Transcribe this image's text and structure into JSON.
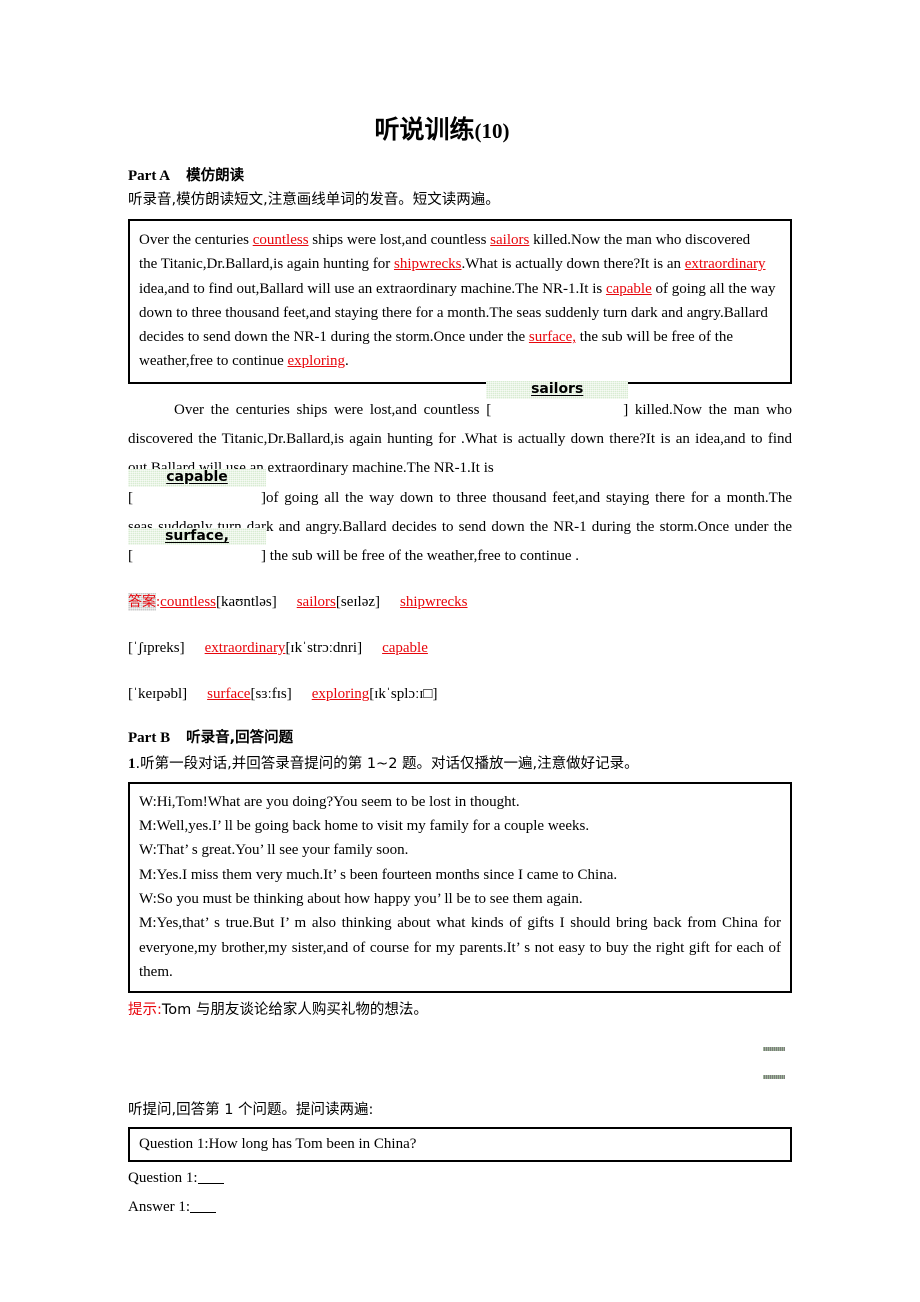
{
  "title": {
    "text": "听说训练",
    "number": "(10)"
  },
  "part_a": {
    "label": "Part A",
    "cn_label": "模仿朗读",
    "instruction": "听录音,模仿朗读短文,注意画线单词的发音。短文读两遍。",
    "passage_lines": [
      {
        "segments": [
          {
            "t": "Over the centuries ",
            "s": "plain"
          },
          {
            "t": "countless",
            "s": "underline-red"
          },
          {
            "t": " ships were lost,and countless ",
            "s": "plain"
          },
          {
            "t": "sailors",
            "s": "underline-red"
          },
          {
            "t": " killed.Now the man who discovered",
            "s": "plain"
          }
        ]
      },
      {
        "segments": [
          {
            "t": " the Titanic,Dr.Ballard,is again hunting for ",
            "s": "plain"
          },
          {
            "t": "shipwrecks",
            "s": "underline-red"
          },
          {
            "t": ".What is actually down there?It is an ",
            "s": "plain"
          },
          {
            "t": "extraordinary",
            "s": "underline-red"
          },
          {
            "t": " idea,and to find out,Ballard will use an extraordinary machine.The NR-1.It is ",
            "s": "plain"
          },
          {
            "t": "capable",
            "s": "underline-red"
          },
          {
            "t": " of going all the way down to three thousand feet,and staying there for a month.The seas suddenly turn dark and angry.Ballard decides to send down the NR-1 during the storm.Once under the ",
            "s": "plain"
          },
          {
            "t": "surface,",
            "s": "underline-red"
          },
          {
            "t": " the sub will be free of the weather,free to continue ",
            "s": "plain"
          },
          {
            "t": "exploring",
            "s": "underline-red"
          },
          {
            "t": ".",
            "s": "plain"
          }
        ]
      }
    ],
    "gap_passage": {
      "p1_pre": "Over the centuries   ships were lost,and countless ",
      "slot1_answer": "sailors",
      "p1_post": " killed.Now the man who discovered the Titanic,Dr.Ballard,is again hunting for .What is actually down there?It is an idea,and to find out,Ballard will use an extraordinary machine.The NR-1.It is ",
      "slot2_answer": "capable",
      "p2_post": "of going all the way down to three thousand feet,and staying there for a month.The seas suddenly turn dark and angry.Ballard decides to send down the NR-1 during the storm.Once under the ",
      "slot3_answer": "surface,",
      "p3_post": " the sub will be free of the weather,free to continue .",
      "bracket_open": "[",
      "bracket_close": "]"
    },
    "answer_key": {
      "label": "答案",
      "colon": ":",
      "line1": [
        {
          "word": "countless",
          "ipa": "[kaʊntləs]"
        },
        {
          "word": "sailors",
          "ipa": "[seɪləz]"
        },
        {
          "word": "shipwrecks",
          "ipa": ""
        }
      ],
      "line2_lead_ipa": "[ˈʃɪpreks]",
      "line2": [
        {
          "word": "extraordinary",
          "ipa": "[ɪkˈstrɔːdnri]"
        },
        {
          "word": "capable",
          "ipa": ""
        }
      ],
      "line3_lead_ipa": "[ˈkeɪpəbl]",
      "line3": [
        {
          "word": "surface",
          "ipa": "[sɜːfɪs]"
        },
        {
          "word": "exploring",
          "ipa": "[ɪkˈsplɔːɪ□]"
        }
      ]
    }
  },
  "part_b": {
    "label": "Part B",
    "cn_label": "听录音,回答问题",
    "q_number": "1",
    "instruction": ".听第一段对话,并回答录音提问的第 1~2 题。对话仅播放一遍,注意做好记录。",
    "dialog": [
      "W:Hi,Tom!What are you doing?You seem to be lost in thought.",
      "M:Well,yes.I’ ll be going back home to visit my family for a couple weeks.",
      "W:That’ s great.You’ ll see your family soon.",
      "M:Yes.I miss them very much.It’ s been fourteen months since I came to China.",
      "W:So you must be thinking about how happy you’ ll be to see them again.",
      "M:Yes,that’ s true.But I’ m also thinking about what kinds of gifts I should bring back from China for everyone,my brother,my sister,and of course for my parents.It’ s not easy to buy the right gift for each of them."
    ],
    "hint_label": "提示:",
    "hint_text": "Tom 与朋友谈论给家人购买礼物的想法。",
    "sub_instruction": "听提问,回答第 1 个问题。提问读两遍:",
    "question_box": "Question 1:How long has Tom been in China?",
    "question_label": "Question 1:",
    "answer_label": "Answer 1:"
  }
}
